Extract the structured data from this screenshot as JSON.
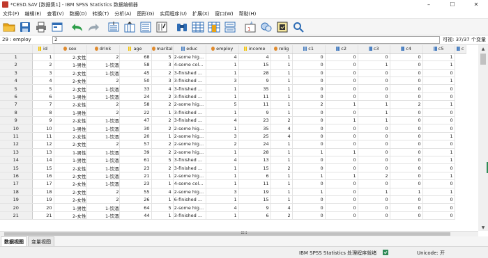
{
  "title_bar": {
    "title": "*CESD.SAV [数据集1] - IBM SPSS Statistics 数据编辑器"
  },
  "menu": [
    "文件(F)",
    "编辑(E)",
    "查看(V)",
    "数据(D)",
    "转换(T)",
    "分析(A)",
    "图形(G)",
    "实用程序(U)",
    "扩展(X)",
    "窗口(W)",
    "帮助(H)"
  ],
  "toolbar": {
    "icons": [
      "open-folder-icon",
      "save-icon",
      "print-icon",
      "dialog-recall-icon",
      "undo-icon",
      "redo-icon",
      "goto-case-icon",
      "goto-variable-icon",
      "variables-icon",
      "run-descriptive-icon",
      "find-icon",
      "insert-cases-icon",
      "insert-variable-icon",
      "split-file-icon",
      "weight-cases-icon",
      "select-cases-icon",
      "value-labels-icon",
      "search-icon"
    ]
  },
  "cell_editor": {
    "reference": "29 : employ",
    "value": "2",
    "visible_info": "可视: 37/37 个变量"
  },
  "columns": [
    {
      "name": "id",
      "measure": "scale"
    },
    {
      "name": "sex",
      "measure": "nominal"
    },
    {
      "name": "drink",
      "measure": "nominal"
    },
    {
      "name": "age",
      "measure": "scale"
    },
    {
      "name": "marital",
      "measure": "nominal"
    },
    {
      "name": "educ",
      "measure": "ordinal"
    },
    {
      "name": "employ",
      "measure": "nominal"
    },
    {
      "name": "income",
      "measure": "scale"
    },
    {
      "name": "relig",
      "measure": "nominal"
    },
    {
      "name": "c1",
      "measure": "ordinal"
    },
    {
      "name": "c2",
      "measure": "ordinal"
    },
    {
      "name": "c3",
      "measure": "ordinal"
    },
    {
      "name": "c4",
      "measure": "ordinal"
    },
    {
      "name": "c5",
      "measure": "ordinal"
    },
    {
      "name": "c",
      "measure": "ordinal"
    }
  ],
  "rows": [
    [
      "1",
      "1",
      "2-女性",
      "2",
      "68",
      "5",
      "2-some hig...",
      "4",
      "4",
      "1",
      "0",
      "0",
      "0",
      "0",
      "1"
    ],
    [
      "2",
      "2",
      "1-男性",
      "1-饮酒",
      "58",
      "3",
      "4-some col...",
      "1",
      "15",
      "1",
      "0",
      "0",
      "1",
      "0",
      "1"
    ],
    [
      "3",
      "3",
      "2-女性",
      "1-饮酒",
      "45",
      "2",
      "3-finished ...",
      "1",
      "28",
      "1",
      "0",
      "0",
      "0",
      "0",
      "0"
    ],
    [
      "4",
      "4",
      "2-女性",
      "2",
      "50",
      "3",
      "3-finished ...",
      "3",
      "9",
      "1",
      "0",
      "0",
      "0",
      "0",
      "1"
    ],
    [
      "5",
      "5",
      "2-女性",
      "1-饮酒",
      "33",
      "4",
      "3-finished ...",
      "1",
      "35",
      "1",
      "0",
      "0",
      "0",
      "0",
      "0"
    ],
    [
      "6",
      "6",
      "1-男性",
      "1-饮酒",
      "24",
      "2",
      "3-finished ...",
      "1",
      "11",
      "1",
      "0",
      "0",
      "0",
      "0",
      "0"
    ],
    [
      "7",
      "7",
      "2-女性",
      "2",
      "58",
      "2",
      "2-some hig...",
      "5",
      "11",
      "1",
      "2",
      "1",
      "1",
      "2",
      "1"
    ],
    [
      "8",
      "8",
      "1-男性",
      "2",
      "22",
      "1",
      "3-finished ...",
      "1",
      "9",
      "1",
      "0",
      "0",
      "1",
      "0",
      "0"
    ],
    [
      "9",
      "9",
      "2-女性",
      "1-饮酒",
      "47",
      "2",
      "3-finished ...",
      "4",
      "23",
      "2",
      "0",
      "1",
      "1",
      "0",
      "0"
    ],
    [
      "10",
      "10",
      "1-男性",
      "1-饮酒",
      "30",
      "2",
      "2-some hig...",
      "1",
      "35",
      "4",
      "0",
      "0",
      "0",
      "0",
      "0"
    ],
    [
      "11",
      "11",
      "2-女性",
      "1-饮酒",
      "20",
      "1",
      "2-some hig...",
      "3",
      "25",
      "4",
      "0",
      "0",
      "0",
      "0",
      "1"
    ],
    [
      "12",
      "12",
      "2-女性",
      "2",
      "57",
      "2",
      "2-some hig...",
      "2",
      "24",
      "1",
      "0",
      "0",
      "0",
      "0",
      "0"
    ],
    [
      "13",
      "13",
      "1-男性",
      "1-饮酒",
      "39",
      "2",
      "2-some hig...",
      "1",
      "28",
      "1",
      "1",
      "1",
      "0",
      "0",
      "1"
    ],
    [
      "14",
      "14",
      "1-男性",
      "1-饮酒",
      "61",
      "5",
      "3-finished ...",
      "4",
      "13",
      "1",
      "0",
      "0",
      "0",
      "0",
      "1"
    ],
    [
      "15",
      "15",
      "2-女性",
      "1-饮酒",
      "23",
      "2",
      "3-finished ...",
      "1",
      "15",
      "2",
      "0",
      "0",
      "0",
      "0",
      "0"
    ],
    [
      "16",
      "16",
      "2-女性",
      "1-饮酒",
      "21",
      "1",
      "2-some hig...",
      "1",
      "6",
      "1",
      "1",
      "1",
      "2",
      "0",
      "1"
    ],
    [
      "17",
      "17",
      "2-女性",
      "1-饮酒",
      "23",
      "1",
      "4-some col...",
      "1",
      "11",
      "1",
      "0",
      "0",
      "0",
      "0",
      "0"
    ],
    [
      "18",
      "18",
      "2-女性",
      "2",
      "55",
      "4",
      "2-some hig...",
      "3",
      "19",
      "1",
      "1",
      "0",
      "1",
      "1",
      "1"
    ],
    [
      "19",
      "19",
      "2-女性",
      "2",
      "26",
      "1",
      "6-finished ...",
      "1",
      "15",
      "1",
      "0",
      "0",
      "0",
      "0",
      "0"
    ],
    [
      "20",
      "20",
      "1-男性",
      "1-饮酒",
      "64",
      "5",
      "2-some hig...",
      "4",
      "9",
      "4",
      "0",
      "0",
      "0",
      "0",
      "0"
    ],
    [
      "21",
      "21",
      "2-女性",
      "1-饮酒",
      "44",
      "1",
      "3-finished ...",
      "1",
      "6",
      "2",
      "0",
      "0",
      "0",
      "0",
      "0"
    ]
  ],
  "tabs": [
    "数据视图",
    "变量视图"
  ],
  "active_tab": "数据视图",
  "status": {
    "processor": "IBM SPSS Statistics 处理程序就绪",
    "unicode": "Unicode: 开"
  }
}
